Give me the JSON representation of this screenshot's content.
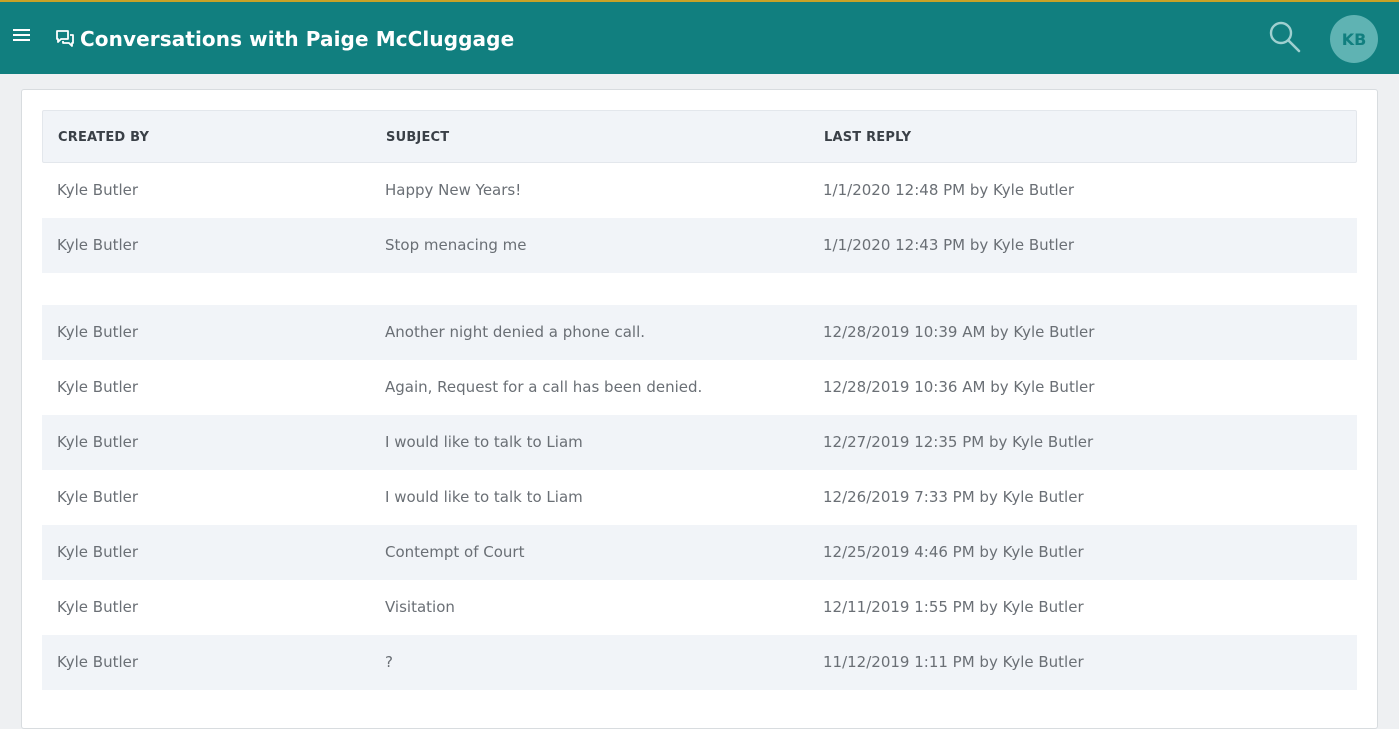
{
  "header": {
    "title": "Conversations with Paige McCluggage",
    "avatar_initials": "KB",
    "icons": {
      "menu": "hamburger-menu-icon",
      "title": "chat-bubbles-icon",
      "search": "search-icon"
    }
  },
  "colors": {
    "appbar": "#117f7f",
    "avatar_bg": "#5fb3b3",
    "row_alt": "#f1f4f8"
  },
  "table": {
    "columns": [
      "CREATED BY",
      "SUBJECT",
      "LAST REPLY"
    ],
    "rows": [
      {
        "created_by": "Kyle Butler",
        "subject": "Happy New Years!",
        "last_reply": "1/1/2020 12:48 PM by Kyle Butler"
      },
      {
        "created_by": "Kyle Butler",
        "subject": "Stop menacing me",
        "last_reply": "1/1/2020 12:43 PM by Kyle Butler"
      },
      {
        "created_by": "Kyle Butler",
        "subject": "Another night denied a phone call.",
        "last_reply": "12/28/2019 10:39 AM by Kyle Butler"
      },
      {
        "created_by": "Kyle Butler",
        "subject": "Again, Request for a call has been denied.",
        "last_reply": "12/28/2019 10:36 AM by Kyle Butler"
      },
      {
        "created_by": "Kyle Butler",
        "subject": "I would like to talk to Liam",
        "last_reply": "12/27/2019 12:35 PM by Kyle Butler"
      },
      {
        "created_by": "Kyle Butler",
        "subject": "I would like to talk to Liam",
        "last_reply": "12/26/2019 7:33 PM by Kyle Butler"
      },
      {
        "created_by": "Kyle Butler",
        "subject": "Contempt of Court",
        "last_reply": "12/25/2019 4:46 PM by Kyle Butler"
      },
      {
        "created_by": "Kyle Butler",
        "subject": "Visitation",
        "last_reply": "12/11/2019 1:55 PM by Kyle Butler"
      },
      {
        "created_by": "Kyle Butler",
        "subject": "?",
        "last_reply": "11/12/2019 1:11 PM by Kyle Butler"
      }
    ]
  }
}
